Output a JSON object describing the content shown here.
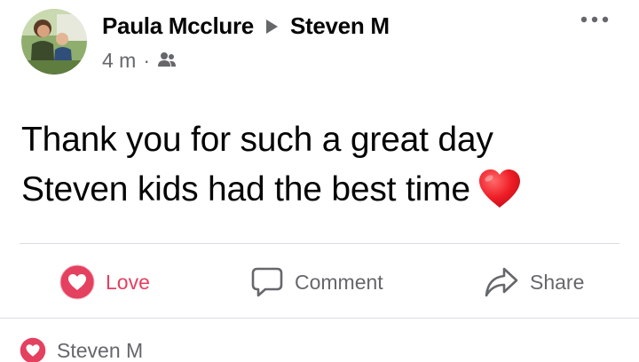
{
  "post": {
    "author": "Paula Mcclure",
    "recipient": "Steven M",
    "time": "4 m",
    "separator": "·",
    "privacy_icon": "friends-icon",
    "text_line1": "Thank you for such a great day",
    "text_line2": "Steven kids had the best time",
    "emoji": "heart-emoji"
  },
  "actions": {
    "love_label": "Love",
    "comment_label": "Comment",
    "share_label": "Share"
  },
  "reactions": {
    "reactor_name": "Steven M",
    "icon": "love-reaction-icon"
  },
  "colors": {
    "love_red": "#e4405f",
    "secondary_text": "#65676b",
    "divider": "#dadde1"
  }
}
